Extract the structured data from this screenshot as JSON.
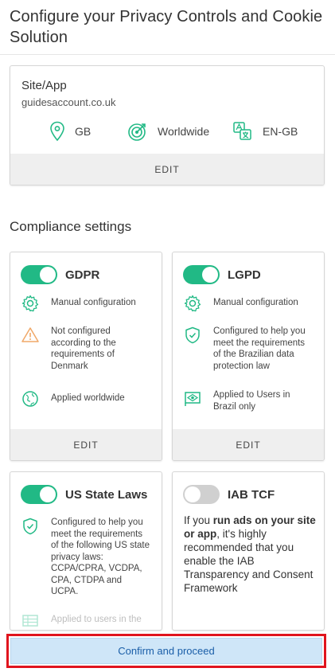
{
  "header": {
    "title": "Configure your Privacy Controls and Cookie Solution"
  },
  "site": {
    "title": "Site/App",
    "domain": "guidesaccount.co.uk",
    "country": "GB",
    "region": "Worldwide",
    "language": "EN-GB",
    "edit_label": "EDIT"
  },
  "compliance": {
    "title": "Compliance settings",
    "gdpr": {
      "name": "GDPR",
      "enabled": true,
      "config": "Manual configuration",
      "status": "Not configured according to the requirements of Denmark",
      "scope": "Applied worldwide",
      "edit_label": "EDIT"
    },
    "lgpd": {
      "name": "LGPD",
      "enabled": true,
      "config": "Manual configuration",
      "status": "Configured to help you meet the requirements of the Brazilian data protection law",
      "scope": "Applied to Users in Brazil only",
      "edit_label": "EDIT"
    },
    "us": {
      "name": "US State Laws",
      "enabled": true,
      "status": "Configured to help you meet the requirements of the following US state privacy laws: CCPA/CPRA, VCDPA, CPA, CTDPA and UCPA.",
      "scope": "Applied to users in the"
    },
    "iab": {
      "name": "IAB TCF",
      "enabled": false,
      "text_before": "If you ",
      "text_bold": "run ads on your site or app",
      "text_after": ", it's highly recommended that you enable the IAB Transparency and Consent Framework"
    }
  },
  "footer": {
    "confirm_label": "Confirm and proceed"
  },
  "colors": {
    "accent": "#21b985",
    "warning": "#f0a868",
    "button_bg": "#cfe6f8",
    "highlight": "#e0141e"
  }
}
